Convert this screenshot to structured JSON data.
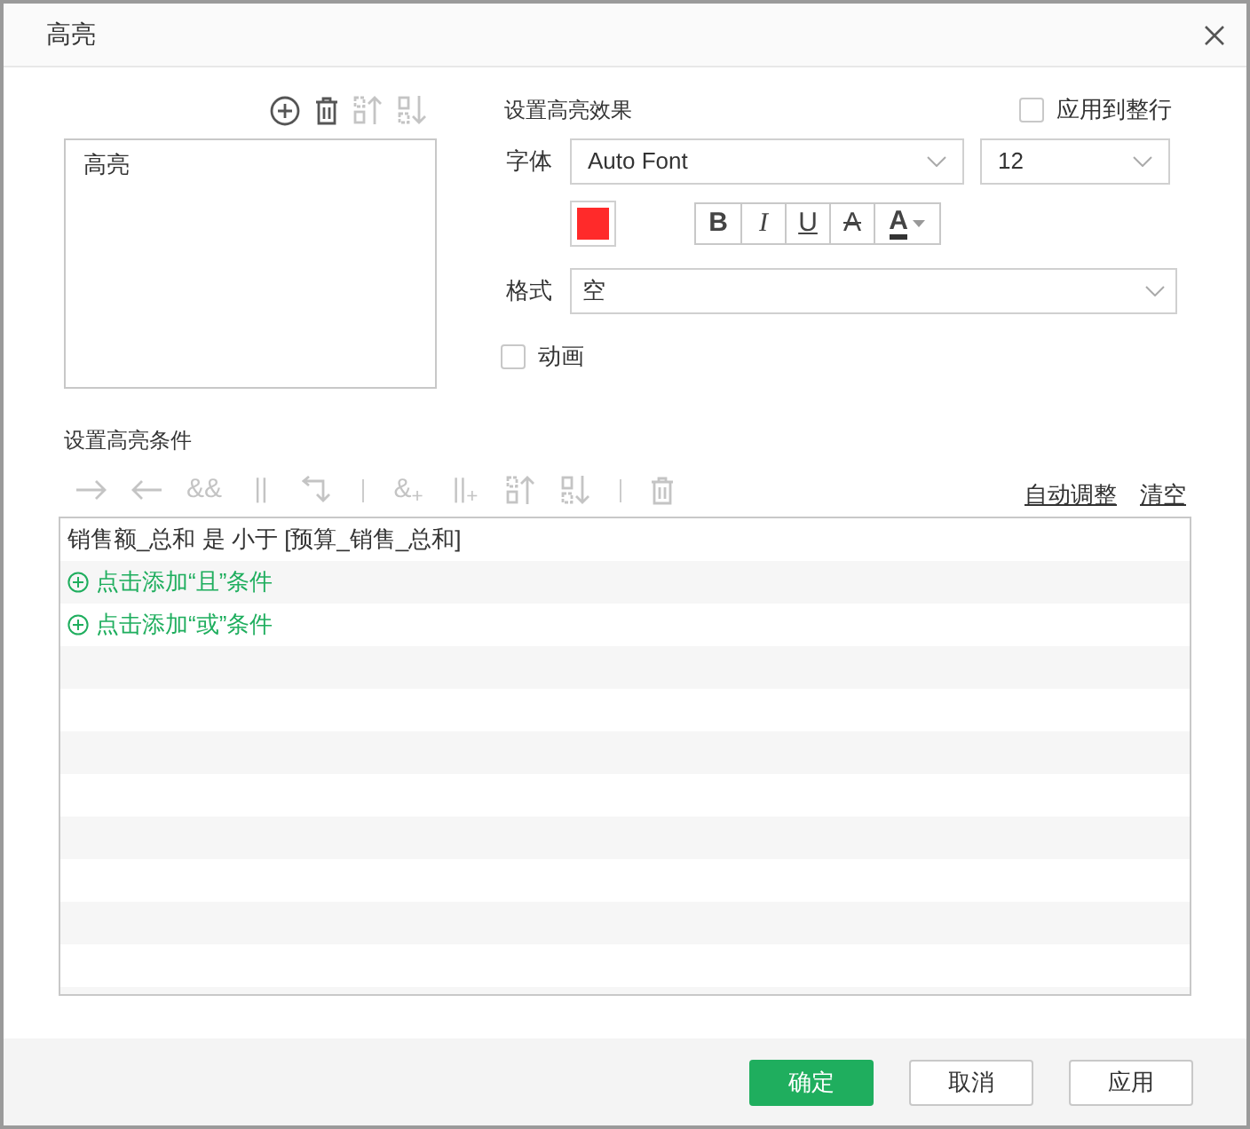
{
  "dialog": {
    "title": "高亮"
  },
  "rule_toolbar": [
    {
      "kind": "add",
      "disabled": false
    },
    {
      "kind": "delete",
      "disabled": false
    },
    {
      "kind": "move_up",
      "disabled": true
    },
    {
      "kind": "move_down",
      "disabled": true
    }
  ],
  "rules": [
    {
      "label": "高亮"
    }
  ],
  "effect": {
    "heading": "设置高亮效果",
    "apply_to_row": {
      "label": "应用到整行",
      "checked": false
    },
    "font_label": "字体",
    "font": "Auto Font",
    "size": "12",
    "color": "#ff2a2a",
    "styles": [
      {
        "kind": "bold",
        "label": "B"
      },
      {
        "kind": "italic",
        "label": "I"
      },
      {
        "kind": "underline",
        "label": "U"
      },
      {
        "kind": "strike",
        "label": "A"
      },
      {
        "kind": "font_color",
        "label": "A",
        "color": "#333333"
      }
    ],
    "format_label": "格式",
    "format": "空",
    "animation": {
      "label": "动画",
      "checked": false
    }
  },
  "conditions": {
    "heading": "设置高亮条件",
    "toolbar": [
      {
        "kind": "arrow_right"
      },
      {
        "kind": "arrow_left"
      },
      {
        "kind": "glyph",
        "text": "&&"
      },
      {
        "kind": "glyph",
        "text": "||"
      },
      {
        "kind": "return"
      },
      {
        "kind": "separator"
      },
      {
        "kind": "glyph",
        "text": "&$_{+}$"
      },
      {
        "kind": "glyph",
        "text": "||$_{+}$"
      },
      {
        "kind": "move_up"
      },
      {
        "kind": "move_down"
      },
      {
        "kind": "separator"
      },
      {
        "kind": "delete"
      }
    ],
    "links": [
      "自动调整",
      "清空"
    ],
    "rows": [
      {
        "kind": "condition",
        "text": "销售额_总和 是 小于 [预算_销售_总和]"
      },
      {
        "kind": "add",
        "text": "点击添加“且”条件"
      },
      {
        "kind": "add",
        "text": "点击添加“或”条件"
      }
    ]
  },
  "buttons": [
    {
      "label": "确定",
      "kind": "primary"
    },
    {
      "label": "取消",
      "kind": "default"
    },
    {
      "label": "应用",
      "kind": "default"
    }
  ]
}
